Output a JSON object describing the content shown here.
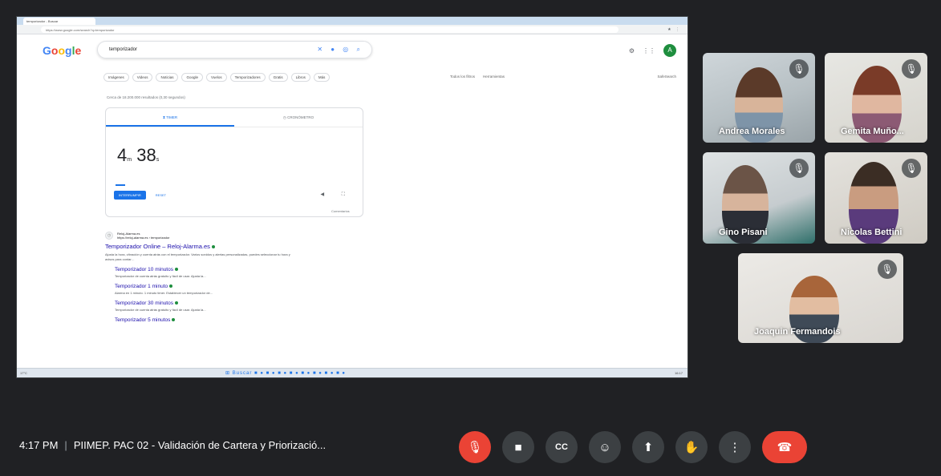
{
  "colors": {
    "background": "#202124",
    "button": "#3c4043",
    "end_call": "#ea4335",
    "google_blue": "#1a73e8"
  },
  "shared_screen": {
    "browser": {
      "tab_title": "temporizador - Buscar",
      "address": "https://www.google.com/search?q=temporizador"
    },
    "google": {
      "logo": [
        "G",
        "o",
        "o",
        "g",
        "l",
        "e"
      ],
      "query": "temporizador",
      "filters": [
        "Imágenes",
        "Videos",
        "Noticias",
        "Google",
        "Vuelos",
        "Temporizadores",
        "Gratis",
        "Libros",
        "Más"
      ],
      "tools": [
        "Todos los filtros",
        "Herramientas"
      ],
      "safe_search": "SafeSearch",
      "result_count": "Cerca de 18.200.000 resultados (0,30 segundos)",
      "timer": {
        "tab_timer": "TIMER",
        "tab_stopwatch": "CRONÓMETRO",
        "minutes": "4",
        "minutes_unit": "m",
        "seconds": "38",
        "seconds_unit": "s",
        "start_label": "INTERRUMPIR",
        "reset_label": "RESET",
        "feedback": "Comentarios"
      },
      "results": {
        "site_name": "Reloj-Alarma.es",
        "site_url": "https://reloj-alarma.es › temporizador",
        "main_title": "Temporizador Online – Reloj-Alarma.es",
        "main_snippet": "Ajusta la hora, vibración y cuenta atrás con el temporizador. Varios sonidos y alertas personalizadas, puedes seleccionar tu hora y avisos para contar…",
        "sub": [
          {
            "title": "Temporizador 10 minutos",
            "snippet": "Temporizador de cuenta atrás gratuito y fácil de usar. Ajusta la..."
          },
          {
            "title": "Temporizador 1 minuto",
            "snippet": "Alarma en 1 minuto. 1 minuto timer. Establecer un temporizador de..."
          },
          {
            "title": "Temporizador 30 minutos",
            "snippet": "Temporizador de cuenta atrás gratuito y fácil de usar. Ajusta la..."
          },
          {
            "title": "Temporizador 5 minutos",
            "snippet": ""
          }
        ]
      }
    },
    "taskbar": {
      "search_label": "Buscar",
      "weather": "17°C",
      "clock": "16:17"
    }
  },
  "participants": [
    {
      "name": "Andrea Morales"
    },
    {
      "name": "Gemita Muño..."
    },
    {
      "name": "Gino Pisani"
    },
    {
      "name": "Nicolas Bettini"
    },
    {
      "name": "Joaquin Fermandois"
    }
  ],
  "meeting": {
    "time": "4:17 PM",
    "separator": "|",
    "title": "PIIMEP. PAC 02 - Validación de Cartera y Priorizació..."
  },
  "controls": [
    {
      "name": "mic-off-icon",
      "glyph": "🎙"
    },
    {
      "name": "camera-icon",
      "glyph": "■"
    },
    {
      "name": "captions-icon",
      "glyph": "CC"
    },
    {
      "name": "emoji-icon",
      "glyph": "☺"
    },
    {
      "name": "present-icon",
      "glyph": "⬆"
    },
    {
      "name": "raise-hand-icon",
      "glyph": "✋"
    },
    {
      "name": "more-options-icon",
      "glyph": "⋮"
    },
    {
      "name": "end-call-icon",
      "glyph": "☎"
    }
  ]
}
